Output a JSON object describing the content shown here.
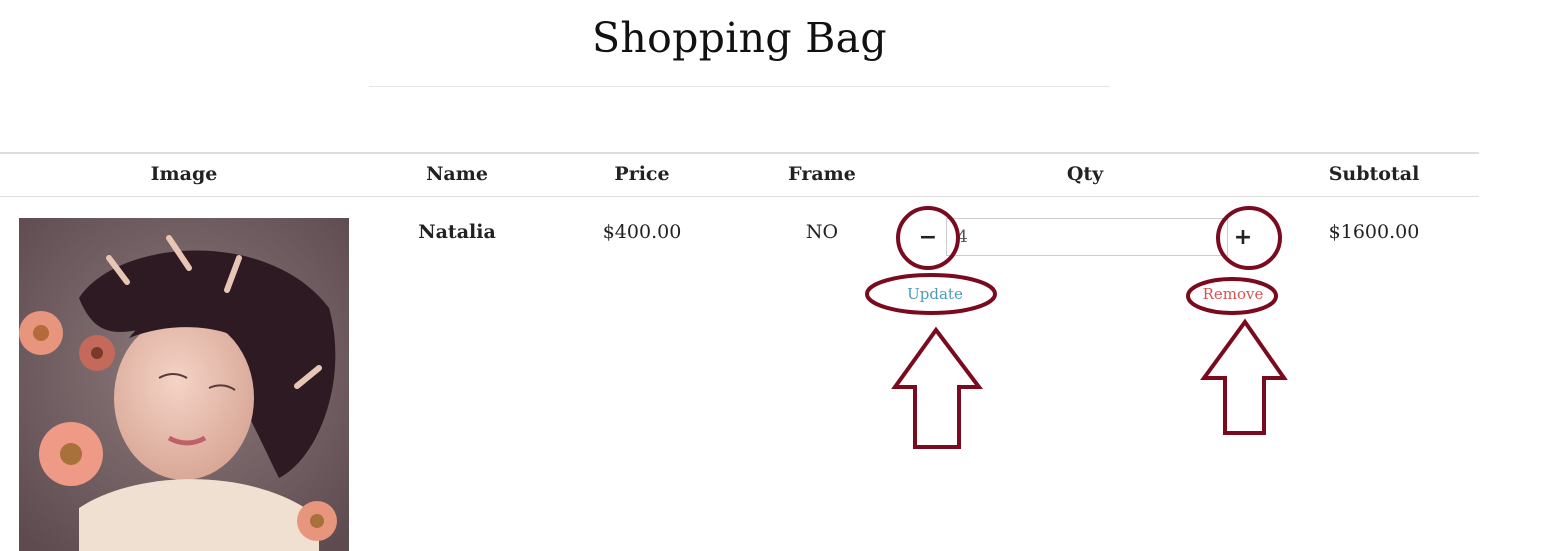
{
  "page": {
    "title": "Shopping Bag"
  },
  "table": {
    "headers": {
      "image": "Image",
      "name": "Name",
      "price": "Price",
      "frame": "Frame",
      "qty": "Qty",
      "subtotal": "Subtotal"
    },
    "rows": [
      {
        "name": "Natalia",
        "price": "$400.00",
        "frame": "NO",
        "qty": "4",
        "subtotal": "$1600.00",
        "decrement_label": "−",
        "increment_label": "+",
        "update_label": "Update",
        "remove_label": "Remove"
      }
    ]
  },
  "colors": {
    "update_link": "#4a9bb8",
    "remove_link": "#d9534f",
    "annotation": "#7a0a1e"
  },
  "icons": [
    "minus-icon",
    "plus-icon",
    "up-arrow-annotation"
  ]
}
